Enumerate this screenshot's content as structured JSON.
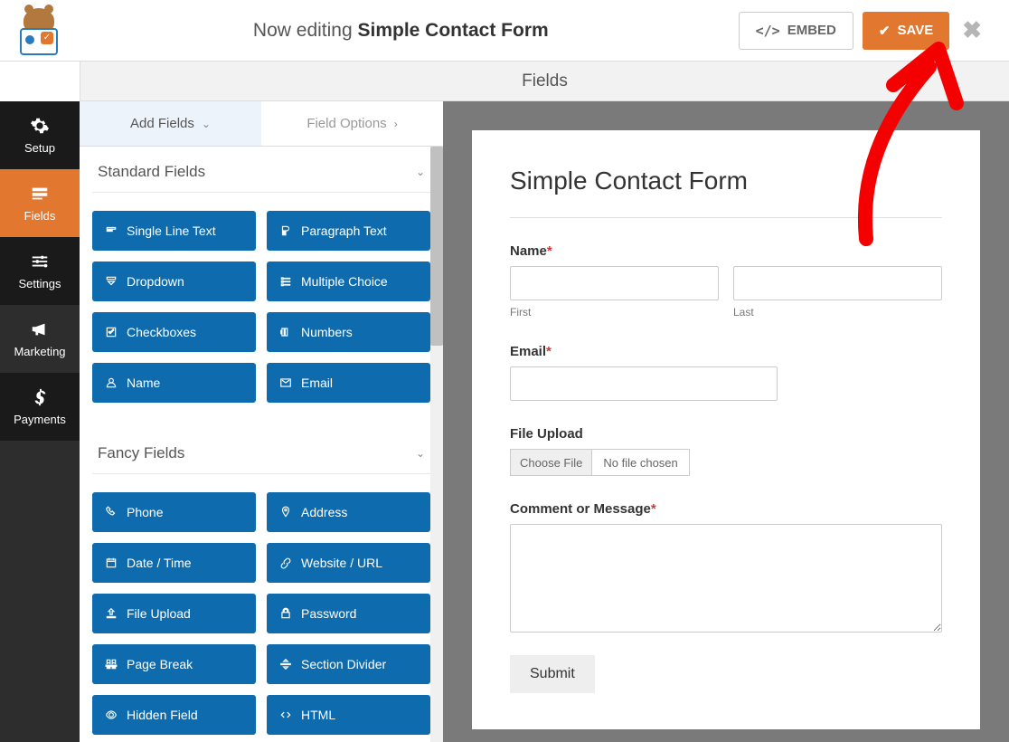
{
  "header": {
    "editing_prefix": "Now editing ",
    "form_name": "Simple Contact Form",
    "embed_label": "EMBED",
    "save_label": "SAVE"
  },
  "section_title": "Fields",
  "leftnav": [
    {
      "id": "setup",
      "label": "Setup"
    },
    {
      "id": "fields",
      "label": "Fields"
    },
    {
      "id": "settings",
      "label": "Settings"
    },
    {
      "id": "marketing",
      "label": "Marketing"
    },
    {
      "id": "payments",
      "label": "Payments"
    }
  ],
  "tabs": {
    "add": "Add Fields",
    "options": "Field Options"
  },
  "groups": {
    "standard": {
      "title": "Standard Fields",
      "items": [
        "Single Line Text",
        "Paragraph Text",
        "Dropdown",
        "Multiple Choice",
        "Checkboxes",
        "Numbers",
        "Name",
        "Email"
      ]
    },
    "fancy": {
      "title": "Fancy Fields",
      "items": [
        "Phone",
        "Address",
        "Date / Time",
        "Website / URL",
        "File Upload",
        "Password",
        "Page Break",
        "Section Divider",
        "Hidden Field",
        "HTML"
      ]
    }
  },
  "form": {
    "title": "Simple Contact Form",
    "name_label": "Name",
    "first": "First",
    "last": "Last",
    "email_label": "Email",
    "file_label": "File Upload",
    "choose_file": "Choose File",
    "no_file": "No file chosen",
    "comment_label": "Comment or Message",
    "submit": "Submit"
  }
}
